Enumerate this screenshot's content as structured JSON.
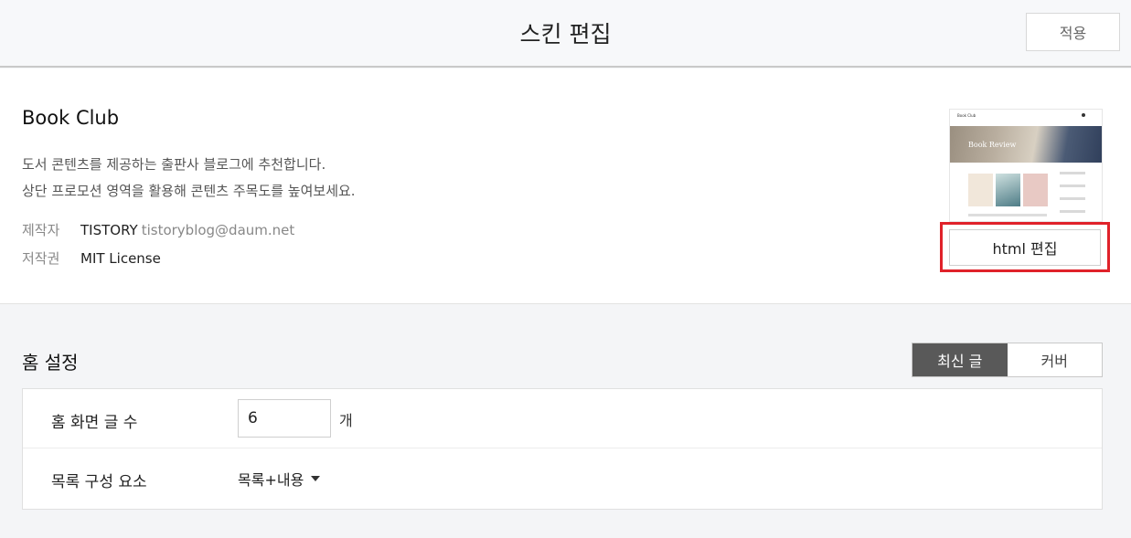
{
  "header": {
    "title": "스킨 편집",
    "apply_label": "적용"
  },
  "skin": {
    "name": "Book Club",
    "description_lines": [
      "도서 콘텐츠를 제공하는 출판사 블로그에 추천합니다.",
      "상단 프로모션 영역을 활용해 콘텐츠 주목도를 높여보세요."
    ],
    "author_label": "제작자",
    "author_name": "TISTORY",
    "author_email": "tistoryblog@daum.net",
    "license_label": "저작권",
    "license_value": "MIT License",
    "preview": {
      "blog_title": "Book Club",
      "banner_text": "Book Review"
    },
    "html_edit_label": "html 편집",
    "highlight_color": "#e0222a"
  },
  "home_settings": {
    "title": "홈 설정",
    "tabs": [
      {
        "label": "최신 글",
        "active": true
      },
      {
        "label": "커버",
        "active": false
      }
    ],
    "rows": {
      "post_count_label": "홈 화면 글 수",
      "post_count_value": "6",
      "post_count_unit": "개",
      "list_composition_label": "목록 구성 요소",
      "list_composition_value": "목록+내용"
    }
  }
}
